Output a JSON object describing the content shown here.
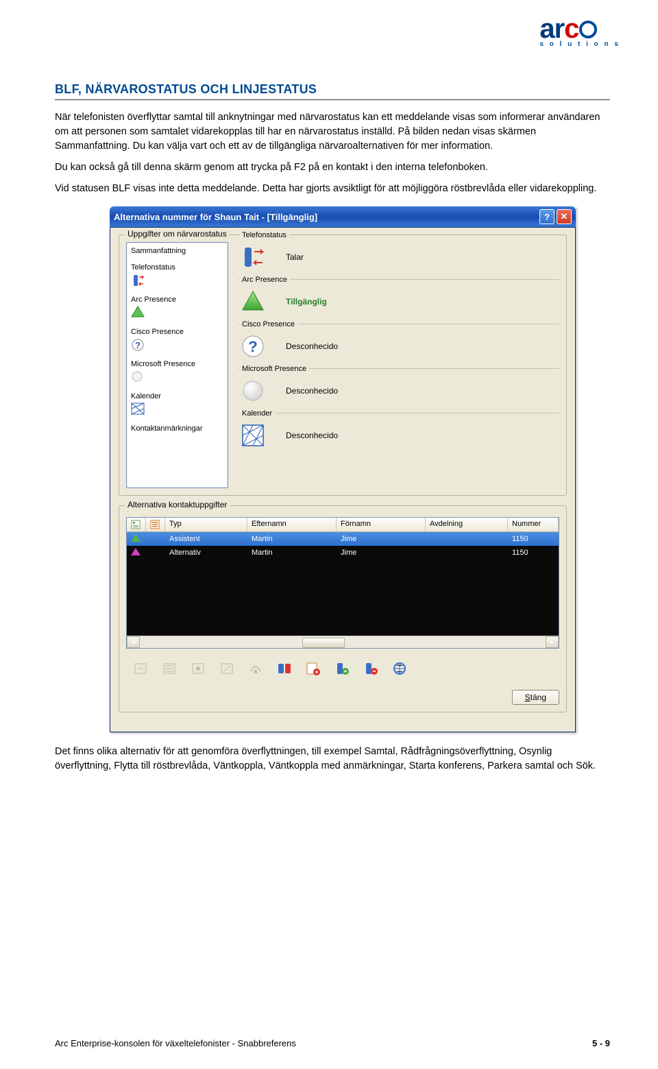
{
  "logo": {
    "sub": "s o l u t i o n s"
  },
  "heading": "BLF, NÄRVAROSTATUS OCH LINJESTATUS",
  "para1": "När telefonisten överflyttar samtal till anknytningar med närvarostatus kan ett meddelande visas som informerar användaren om att personen som samtalet vidarekopplas till har en närvarostatus inställd. På bilden nedan visas skärmen Sammanfattning. Du kan välja vart och ett av de tillgängliga närvaroalternativen för mer information.",
  "para2": "Du kan också gå till denna skärm genom att trycka på F2 på en kontakt i den interna telefonboken.",
  "para3": "Vid statusen BLF visas inte detta meddelande. Detta har gjorts avsiktligt för att möjliggöra röstbrevlåda eller vidarekoppling.",
  "dialog": {
    "title": "Alternativa nummer för Shaun Tait - [Tillgänglig]",
    "fs1_label": "Uppgifter om närvarostatus",
    "side": {
      "i0": "Sammanfattning",
      "i1": "Telefonstatus",
      "i2": "Arc Presence",
      "i3": "Cisco Presence",
      "i4": "Microsoft Presence",
      "i5": "Kalender",
      "i6": "Kontaktanmärkningar"
    },
    "grp": {
      "g0_label": "Telefonstatus",
      "g0_text": "Talar",
      "g1_label": "Arc Presence",
      "g1_text": "Tillgänglig",
      "g2_label": "Cisco Presence",
      "g2_text": "Desconhecido",
      "g3_label": "Microsoft Presence",
      "g3_text": "Desconhecido",
      "g4_label": "Kalender",
      "g4_text": "Desconhecido"
    },
    "fs2_label": "Alternativa kontaktuppgifter",
    "columns": {
      "typ": "Typ",
      "eft": "Efternamn",
      "forn": "Förnamn",
      "avd": "Avdelning",
      "num": "Nummer"
    },
    "rows": [
      {
        "typ": "Assistent",
        "eft": "Martin",
        "forn": "Jime",
        "avd": "",
        "num": "1150"
      },
      {
        "typ": "Alternativ",
        "eft": "Martin",
        "forn": "Jime",
        "avd": "",
        "num": "1150"
      }
    ],
    "close_btn": "Stäng"
  },
  "para4": "Det finns olika alternativ för att genomföra överflyttningen, till exempel Samtal, Rådfrågningsöverflyttning, Osynlig överflyttning, Flytta till röstbrevlåda, Väntkoppla, Väntkoppla med anmärkningar, Starta konferens, Parkera samtal och Sök.",
  "footer_left": "Arc Enterprise-konsolen för växeltelefonister - Snabbreferens",
  "footer_right": "5 - 9"
}
